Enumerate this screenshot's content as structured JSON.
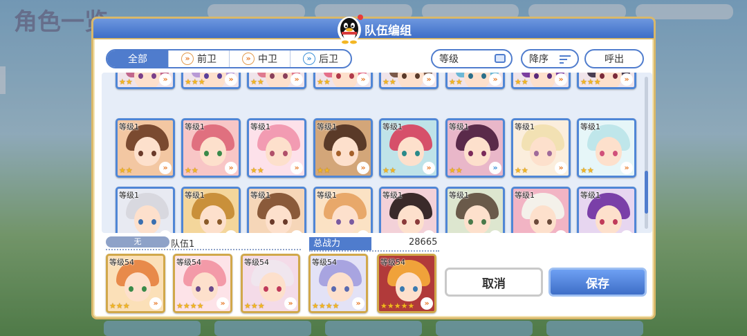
{
  "background": {
    "title": "角色一览"
  },
  "dialog": {
    "title": "队伍编组"
  },
  "filters": {
    "tabs": [
      {
        "label": "全部",
        "active": true
      },
      {
        "label": "前卫",
        "icon": "vanguard-icon"
      },
      {
        "label": "中卫",
        "icon": "midguard-icon"
      },
      {
        "label": "后卫",
        "icon": "rearguard-icon"
      }
    ],
    "sort_field": "等级",
    "sort_order": "降序",
    "call_label": "呼出"
  },
  "roster": {
    "partial_row": [
      {
        "stars": "★★",
        "hair": "#c2678c",
        "eye": "#7a3f8a"
      },
      {
        "stars": "★★★",
        "hair": "#b89ad6",
        "eye": "#5a3f9a"
      },
      {
        "stars": "★★",
        "hair": "#e07b8f",
        "eye": "#8a3f5a"
      },
      {
        "stars": "★★",
        "hair": "#e56f8a",
        "eye": "#b03a4a"
      },
      {
        "stars": "★★",
        "hair": "#7b5a4a",
        "eye": "#5a3a2a"
      },
      {
        "stars": "★★",
        "hair": "#6cb8d6",
        "eye": "#2a6f8a"
      },
      {
        "stars": "★★",
        "hair": "#7b3fa0",
        "eye": "#5a2a7a"
      },
      {
        "stars": "★★★",
        "hair": "#4a3f52",
        "eye": "#7a2a3a"
      }
    ],
    "rows": [
      [
        {
          "level": "等级1",
          "stars": "★★",
          "hair": "#7a4a30",
          "eye": "#6a3a2a",
          "bg": "#f3c7a2",
          "pos": "rear"
        },
        {
          "level": "等级1",
          "stars": "★★",
          "hair": "#e0707f",
          "eye": "#3a8a4a",
          "bg": "#f8c6c6",
          "pos": "rear"
        },
        {
          "level": "等级1",
          "stars": "★★",
          "hair": "#f29bb2",
          "eye": "#b0506a",
          "bg": "#fde1ea",
          "pos": "rear"
        },
        {
          "level": "等级1",
          "stars": "★★",
          "hair": "#5a3a28",
          "eye": "#a5602a",
          "bg": "#d3a679",
          "pos": "rear"
        },
        {
          "level": "等级1",
          "stars": "★★",
          "hair": "#d6506a",
          "eye": "#2a8a8a",
          "bg": "#bfe3e8",
          "pos": "rear"
        },
        {
          "level": "等级1",
          "stars": "★★",
          "hair": "#5a2a4a",
          "eye": "#7a2a5a",
          "bg": "#e9b7c9",
          "pos": "mid"
        },
        {
          "level": "等级1",
          "stars": "★★",
          "hair": "#f2e1b3",
          "eye": "#a06a9a",
          "bg": "#fbeedd",
          "pos": "rear"
        },
        {
          "level": "等级1",
          "stars": "★★",
          "hair": "#bfe6ea",
          "eye": "#d0507a",
          "bg": "#e6f6f8",
          "pos": "rear"
        }
      ],
      [
        {
          "level": "等级1",
          "stars": "★★",
          "hair": "#d8d8df",
          "eye": "#3a6fb0",
          "bg": "#e8eaf2",
          "pos": "mid"
        },
        {
          "level": "等级1",
          "stars": "★★",
          "hair": "#c9903a",
          "eye": "#8a5a2a",
          "bg": "#f4d69b",
          "pos": "rear"
        },
        {
          "level": "等级1",
          "stars": "★★",
          "hair": "#8a5a3a",
          "eye": "#6a3a2a",
          "bg": "#f6d6b8",
          "pos": "mid"
        },
        {
          "level": "等级1",
          "stars": "★",
          "hair": "#e8a86a",
          "eye": "#7a5aa0",
          "bg": "#fbe2c4",
          "pos": "mid"
        },
        {
          "level": "等级1",
          "stars": "★",
          "hair": "#3a2a2a",
          "eye": "#8a3a3a",
          "bg": "#f3d1d8",
          "pos": "rear"
        },
        {
          "level": "等级1",
          "stars": "★",
          "hair": "#6a5a4a",
          "eye": "#4a7a4a",
          "bg": "#dde6cf",
          "pos": "rear"
        },
        {
          "level": "等级1",
          "stars": "★",
          "hair": "#f4f1ea",
          "eye": "#6a4a3a",
          "bg": "#f2b4c4",
          "pos": "rear"
        },
        {
          "level": "等级1",
          "stars": "★",
          "hair": "#7a3fa8",
          "eye": "#c03a5a",
          "bg": "#e7d6f0",
          "pos": "mid"
        }
      ]
    ]
  },
  "team": {
    "slot_label": "无",
    "name": "队伍1",
    "power_label": "总战力",
    "power_value": "28665",
    "members": [
      {
        "level": "等级54",
        "stars": "★★★",
        "hair": "#e88a4a",
        "eye": "#3a8a4a",
        "bg": "#fbe0b8"
      },
      {
        "level": "等级54",
        "stars": "★★★★",
        "hair": "#f39aa8",
        "eye": "#6a4a8a",
        "bg": "#fde3e8"
      },
      {
        "level": "等级54",
        "stars": "★★★",
        "hair": "#f0e6ee",
        "eye": "#c03a5a",
        "bg": "#f4dbe8"
      },
      {
        "level": "等级54",
        "stars": "★★★★",
        "hair": "#a8a4e0",
        "eye": "#5a6ab0",
        "bg": "#e3e2f6"
      },
      {
        "level": "等级54",
        "stars": "★★★★★",
        "hair": "#f0a23a",
        "eye": "#3a7ab0",
        "bg": "#b13a3a"
      }
    ]
  },
  "buttons": {
    "cancel": "取消",
    "save": "保存"
  }
}
